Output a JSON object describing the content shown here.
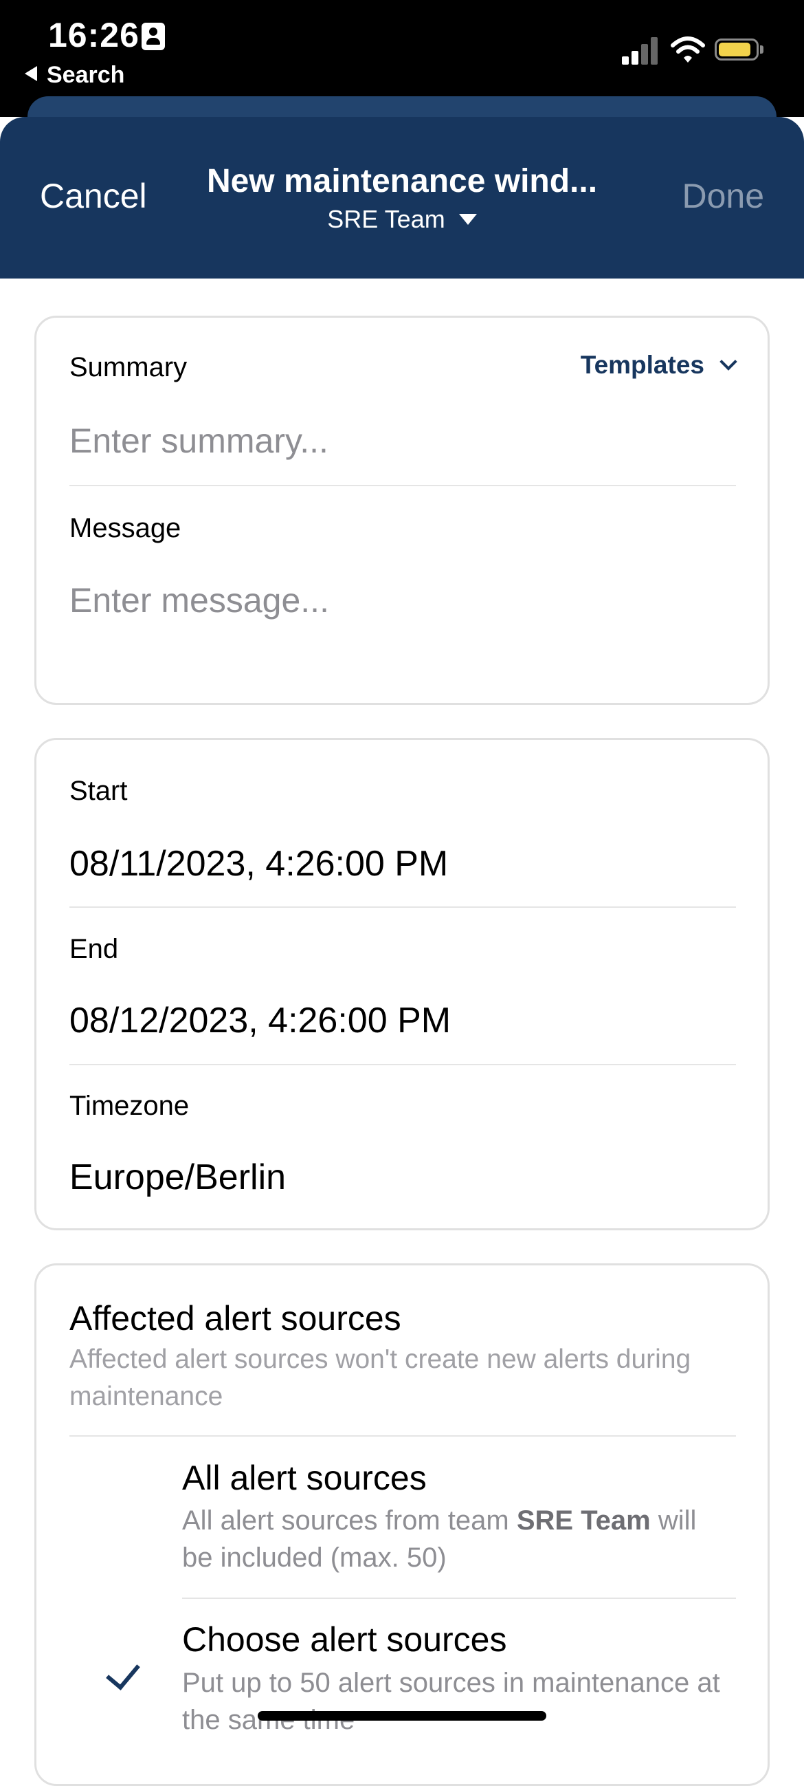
{
  "status_bar": {
    "time": "16:26",
    "back_label": "Search"
  },
  "navbar": {
    "cancel_label": "Cancel",
    "title": "New maintenance wind...",
    "team": "SRE Team",
    "done_label": "Done"
  },
  "details_card": {
    "summary_label": "Summary",
    "templates_label": "Templates",
    "summary_placeholder": "Enter summary...",
    "message_label": "Message",
    "message_placeholder": "Enter message..."
  },
  "time_card": {
    "start_label": "Start",
    "start_value": "08/11/2023, 4:26:00 PM",
    "end_label": "End",
    "end_value": "08/12/2023, 4:26:00 PM",
    "timezone_label": "Timezone",
    "timezone_value": "Europe/Berlin"
  },
  "alert_sources": {
    "title": "Affected alert sources",
    "subtitle": "Affected alert sources won't create new alerts during maintenance",
    "options": [
      {
        "title": "All alert sources",
        "desc_prefix": "All alert sources from team ",
        "desc_bold": "SRE Team",
        "desc_suffix": " will be included (max. 50)",
        "selected": false
      },
      {
        "title": "Choose alert sources",
        "desc": "Put up to 50 alert sources in maintenance at the same time",
        "selected": true
      }
    ]
  },
  "colors": {
    "navbar_bg": "#17365e",
    "accent": "#17365e",
    "placeholder": "#8e8e93"
  }
}
